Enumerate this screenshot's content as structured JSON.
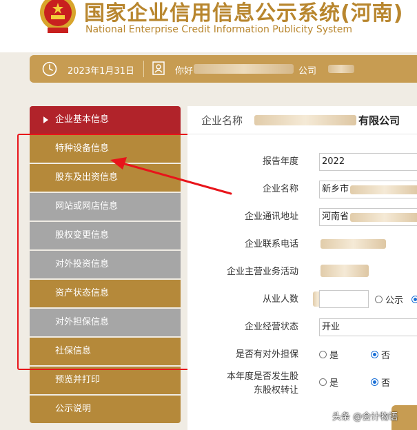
{
  "header": {
    "title_cn": "国家企业信用信息公示系统(河南)",
    "title_en": "National Enterprise Credit Information Publicity System"
  },
  "status": {
    "date": "2023年1月31日",
    "greeting_start": "你好",
    "greeting_end": "公司"
  },
  "sidebar": {
    "items": [
      {
        "label": "企业基本信息",
        "state": "active"
      },
      {
        "label": "特种设备信息",
        "state": "gold"
      },
      {
        "label": "股东及出资信息",
        "state": "gold"
      },
      {
        "label": "网站或网店信息",
        "state": "grey"
      },
      {
        "label": "股权变更信息",
        "state": "grey"
      },
      {
        "label": "对外投资信息",
        "state": "grey"
      },
      {
        "label": "资产状态信息",
        "state": "gold"
      },
      {
        "label": "对外担保信息",
        "state": "grey"
      },
      {
        "label": "社保信息",
        "state": "gold"
      },
      {
        "label": "预览并打印",
        "state": "gold"
      },
      {
        "label": "公示说明",
        "state": "gold"
      }
    ]
  },
  "main": {
    "enterprise_label": "企业名称",
    "enterprise_suffix": "有限公司",
    "rows": {
      "year": {
        "label": "报告年度",
        "value": "2022"
      },
      "name": {
        "label": "企业名称",
        "value": "新乡市"
      },
      "address": {
        "label": "企业通讯地址",
        "value": "河南省"
      },
      "phone": {
        "label": "企业联系电话"
      },
      "business": {
        "label": "企业主营业务活动"
      },
      "employees": {
        "label": "从业人数",
        "public": "公示"
      },
      "status": {
        "label": "企业经营状态",
        "value": "开业"
      },
      "guarantee": {
        "label": "是否有对外担保",
        "yes": "是",
        "no": "否",
        "selected": "否"
      },
      "equity": {
        "label_line1": "本年度是否发生股",
        "label_line2": "东股权转让",
        "yes": "是",
        "no": "否",
        "selected": "否"
      }
    }
  },
  "watermark": "头条 @会计物语",
  "colors": {
    "gold": "#b5893a",
    "active_red": "#b1232a",
    "grey": "#a6a6a6",
    "highlight": "#e8141a",
    "title": "#b8862e"
  }
}
